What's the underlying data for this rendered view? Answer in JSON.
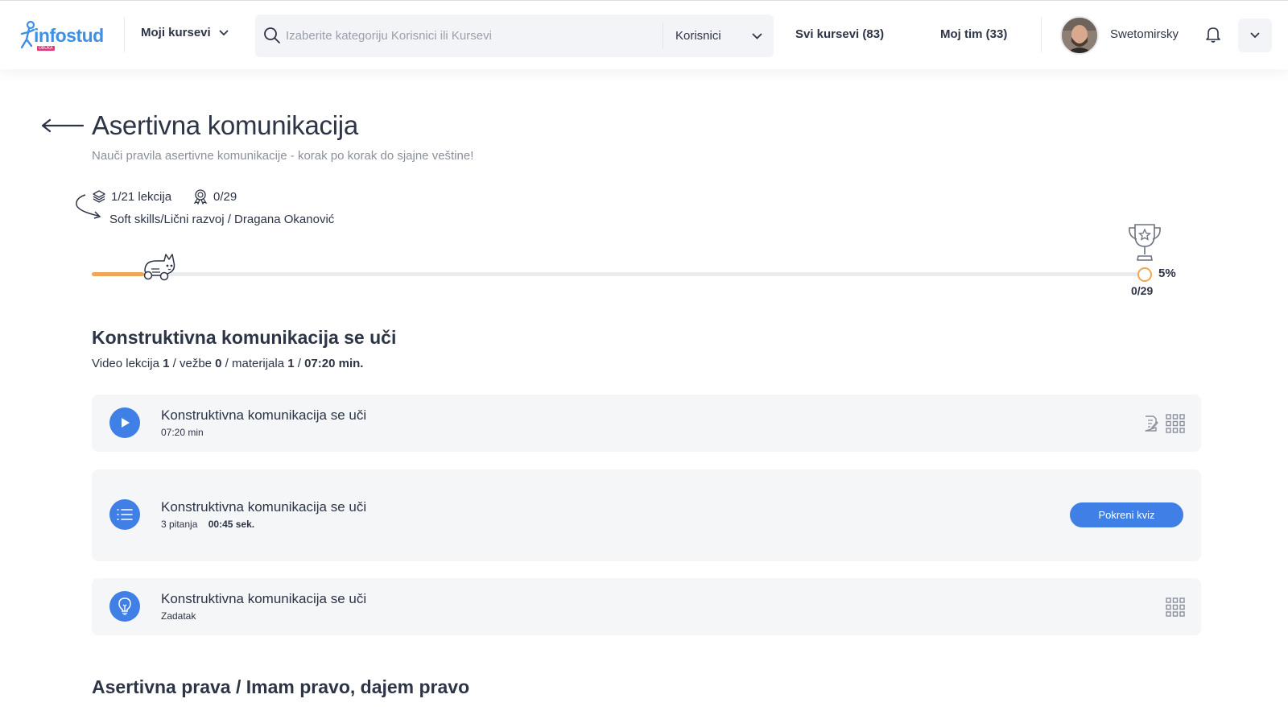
{
  "header": {
    "logo_text": "infostud",
    "logo_sub": "OBUKA",
    "my_courses_label": "Moji kursevi",
    "search_placeholder": "Izaberite kategoriju Korisnici ili Kursevi",
    "search_category": "Korisnici",
    "all_courses_label": "Svi kursevi (83)",
    "my_team_label": "Moj tim (33)",
    "username": "Swetomirsky"
  },
  "course": {
    "title": "Asertivna komunikacija",
    "subtitle": "Nauči pravila asertivne komunikacije - korak po korak do sjajne veštine!",
    "lessons_progress": "1/21 lekcija",
    "points": "0/29",
    "category_author": "Soft skills/Lični razvoj / Dragana Okanović"
  },
  "progress": {
    "percent_label": "5%",
    "percent_value": 5,
    "points_label": "0/29"
  },
  "section": {
    "title": "Konstruktivna komunikacija se uči",
    "info_prefix": "Video lekcija ",
    "video_count": "1",
    "info_exercises": " / vežbe ",
    "exercise_count": "0",
    "info_materials": " / materijala ",
    "material_count": "1",
    "info_sep": " / ",
    "duration": "07:20 min."
  },
  "items": [
    {
      "title": "Konstruktivna komunikacija se uči",
      "sub": "07:20 min",
      "icon": "play-icon"
    },
    {
      "title": "Konstruktivna komunikacija se uči",
      "questions": "3 pitanja",
      "duration": "00:45 sek.",
      "button": "Pokreni kviz",
      "icon": "list-icon"
    },
    {
      "title": "Konstruktivna komunikacija se uči",
      "sub": "Zadatak",
      "icon": "lightbulb-icon"
    }
  ],
  "next_section": {
    "title": "Asertivna prava / Imam pravo, dajem pravo"
  },
  "colors": {
    "primary": "#3f7fe6",
    "progress": "#f0a656",
    "text": "#2c3446",
    "card_bg": "#f5f6f8"
  }
}
